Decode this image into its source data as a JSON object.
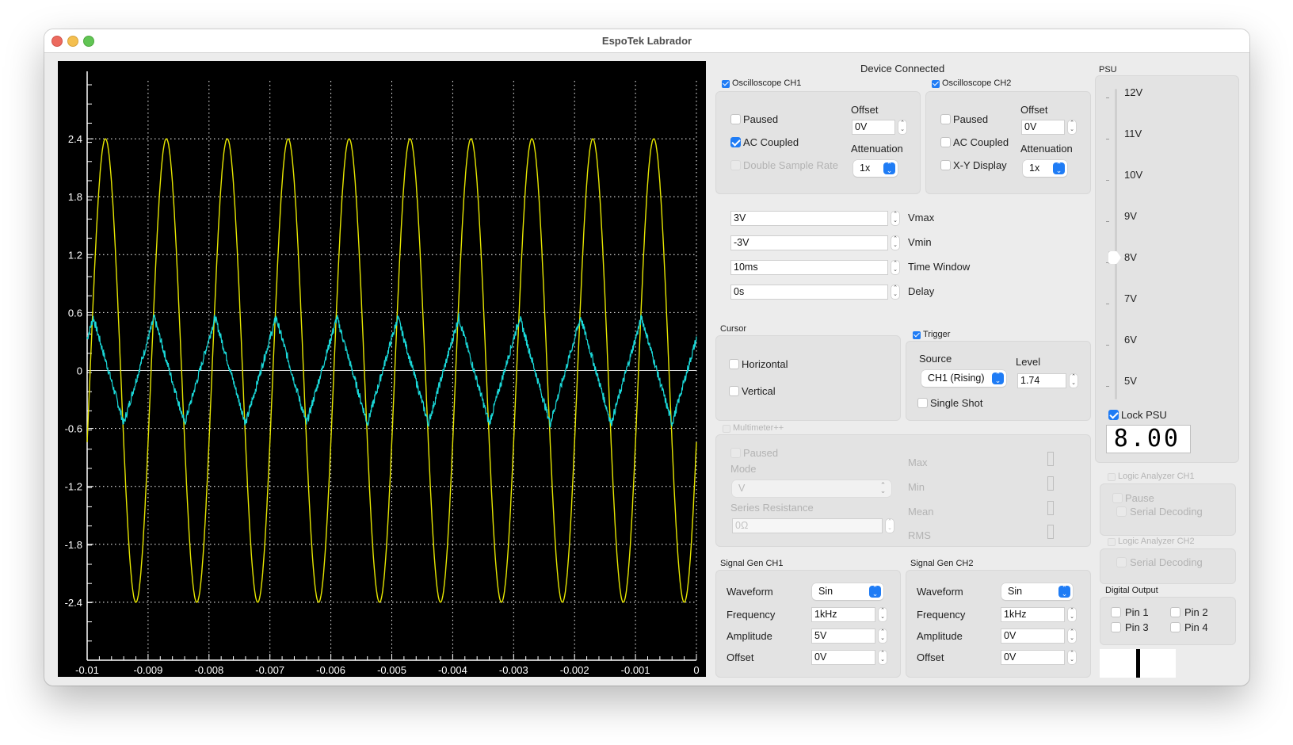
{
  "window": {
    "title": "EspoTek Labrador"
  },
  "status": "Device Connected",
  "oscilloscope_ch1": {
    "title": "Oscilloscope CH1",
    "enabled": true,
    "paused_label": "Paused",
    "paused": false,
    "ac_coupled_label": "AC Coupled",
    "ac_coupled": true,
    "double_sample_rate_label": "Double Sample Rate",
    "double_sample_rate": false,
    "offset_label": "Offset",
    "offset_value": "0V",
    "attenuation_label": "Attenuation",
    "attenuation_value": "1x"
  },
  "oscilloscope_ch2": {
    "title": "Oscilloscope CH2",
    "enabled": true,
    "paused_label": "Paused",
    "paused": false,
    "ac_coupled_label": "AC Coupled",
    "ac_coupled": false,
    "xy_display_label": "X-Y Display",
    "xy_display": false,
    "offset_label": "Offset",
    "offset_value": "0V",
    "attenuation_label": "Attenuation",
    "attenuation_value": "1x"
  },
  "scope_settings": {
    "vmax": {
      "label": "Vmax",
      "value": "3V"
    },
    "vmin": {
      "label": "Vmin",
      "value": "-3V"
    },
    "time_window": {
      "label": "Time Window",
      "value": "10ms"
    },
    "delay": {
      "label": "Delay",
      "value": "0s"
    }
  },
  "cursor": {
    "title": "Cursor",
    "horizontal_label": "Horizontal",
    "vertical_label": "Vertical"
  },
  "trigger": {
    "title": "Trigger",
    "enabled": true,
    "source_label": "Source",
    "source_value": "CH1 (Rising)",
    "level_label": "Level",
    "level_value": "1.74",
    "single_shot_label": "Single Shot"
  },
  "multimeter": {
    "title": "Multimeter++",
    "paused_label": "Paused",
    "mode_label": "Mode",
    "mode_value": "V",
    "series_resistance_label": "Series Resistance",
    "series_resistance_value": "0Ω",
    "max_label": "Max",
    "min_label": "Min",
    "mean_label": "Mean",
    "rms_label": "RMS"
  },
  "signal_gen_ch1": {
    "title": "Signal Gen CH1",
    "waveform_label": "Waveform",
    "waveform_value": "Sin",
    "frequency_label": "Frequency",
    "frequency_value": "1kHz",
    "amplitude_label": "Amplitude",
    "amplitude_value": "5V",
    "offset_label": "Offset",
    "offset_value": "0V"
  },
  "signal_gen_ch2": {
    "title": "Signal Gen CH2",
    "waveform_label": "Waveform",
    "waveform_value": "Sin",
    "frequency_label": "Frequency",
    "frequency_value": "1kHz",
    "amplitude_label": "Amplitude",
    "amplitude_value": "0V",
    "offset_label": "Offset",
    "offset_value": "0V"
  },
  "psu": {
    "title": "PSU",
    "scale_labels": [
      "12V",
      "11V",
      "10V",
      "9V",
      "8V",
      "7V",
      "6V",
      "5V"
    ],
    "value_volts": 8.0,
    "lock_label": "Lock PSU",
    "locked": true,
    "display": "8.00"
  },
  "logic_analyzer_ch1": {
    "title": "Logic Analyzer CH1",
    "pause_label": "Pause",
    "serial_decoding_label": "Serial Decoding"
  },
  "logic_analyzer_ch2": {
    "title": "Logic Analyzer CH2",
    "serial_decoding_label": "Serial Decoding"
  },
  "digital_output": {
    "title": "Digital Output",
    "pins": [
      "Pin 1",
      "Pin 2",
      "Pin 3",
      "Pin 4"
    ]
  },
  "colors": {
    "ch1_trace": "#e6e600",
    "ch2_trace": "#1ad9d9",
    "plot_bg": "#000000",
    "accent": "#1f7cf5"
  },
  "chart_data": {
    "type": "line",
    "title": "",
    "xlabel": "",
    "ylabel": "",
    "xlim": [
      -0.01,
      0
    ],
    "ylim": [
      -3,
      3
    ],
    "grid": true,
    "x_ticks": [
      "-0.01",
      "-0.009",
      "-0.008",
      "-0.007",
      "-0.006",
      "-0.005",
      "-0.004",
      "-0.003",
      "-0.002",
      "-0.001",
      "0"
    ],
    "y_ticks": [
      "2.4",
      "1.8",
      "1.2",
      "0.6",
      "0",
      "-0.6",
      "-1.2",
      "-1.8",
      "-2.4"
    ],
    "series": [
      {
        "name": "CH1",
        "shape": "sine",
        "amplitude": 2.4,
        "frequency_hz": 1000,
        "peaks_x": [
          -0.0097,
          -0.0087,
          -0.0077,
          -0.0067,
          -0.0057,
          -0.0047,
          -0.0037,
          -0.0027,
          -0.0017,
          -0.0007
        ]
      },
      {
        "name": "CH2",
        "shape": "triangle-noisy",
        "amplitude": 0.55,
        "frequency_hz": 1000,
        "peaks_x": [
          -0.0099,
          -0.0089,
          -0.0079,
          -0.0069,
          -0.0059,
          -0.0049,
          -0.0039,
          -0.0029,
          -0.0019,
          -0.0009
        ]
      }
    ]
  }
}
